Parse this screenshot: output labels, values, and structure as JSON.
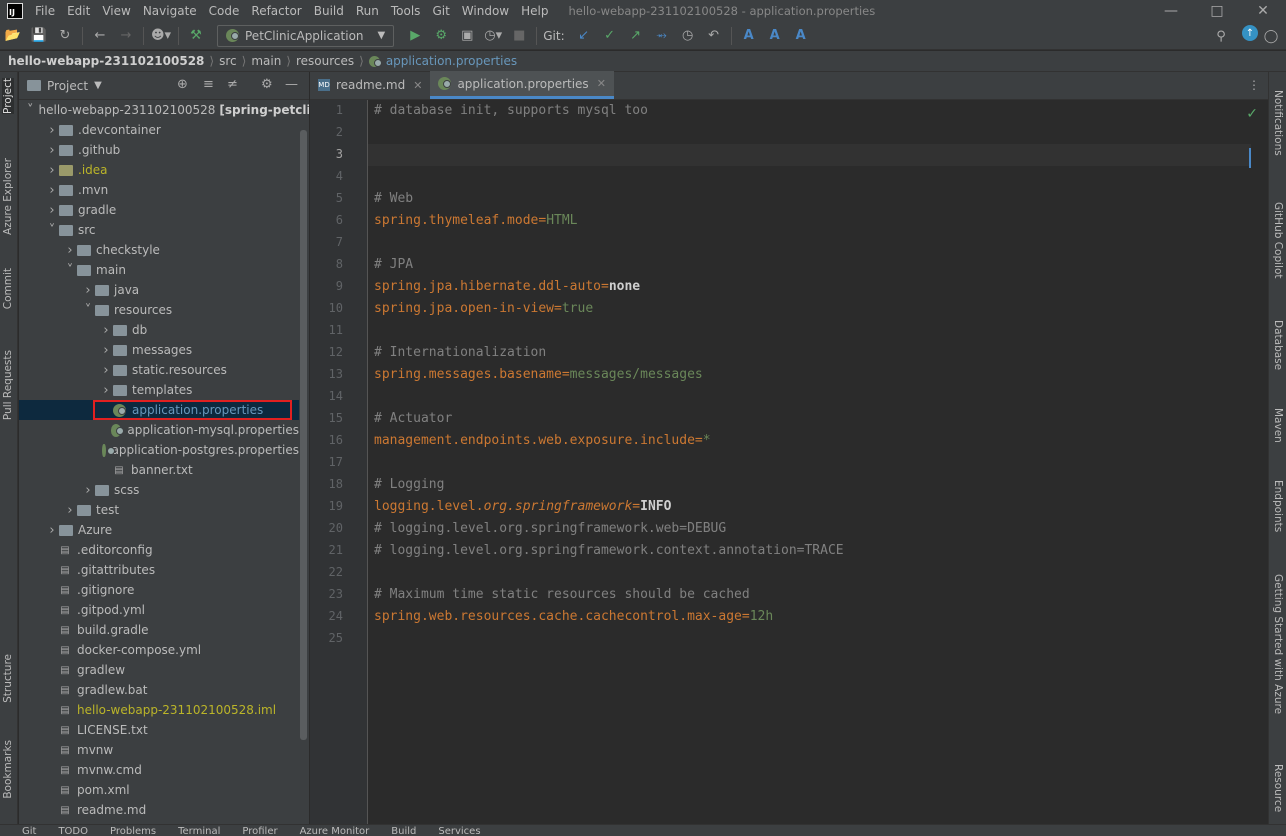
{
  "menu": [
    "File",
    "Edit",
    "View",
    "Navigate",
    "Code",
    "Refactor",
    "Build",
    "Run",
    "Tools",
    "Git",
    "Window",
    "Help"
  ],
  "window_title": "hello-webapp-231102100528 - application.properties",
  "toolbar": {
    "run_config": "PetClinicApplication",
    "git_label": "Git:"
  },
  "breadcrumbs": [
    "hello-webapp-231102100528",
    "src",
    "main",
    "resources",
    "application.properties"
  ],
  "left_strip": [
    "Project",
    "Azure Explorer",
    "Commit",
    "Pull Requests",
    "Structure",
    "Bookmarks"
  ],
  "right_strip": [
    "Notifications",
    "GitHub Copilot",
    "Database",
    "Maven",
    "Endpoints",
    "Getting Started with Azure",
    "Resource"
  ],
  "project_panel": {
    "title": "Project"
  },
  "tree": [
    {
      "label": "hello-webapp-231102100528",
      "extra": "[spring-petclinic]",
      "depth": 0,
      "type": "folder",
      "expanded": true
    },
    {
      "label": ".devcontainer",
      "depth": 1,
      "type": "folder"
    },
    {
      "label": ".github",
      "depth": 1,
      "type": "folder"
    },
    {
      "label": ".idea",
      "depth": 1,
      "type": "folder",
      "color": "yellow"
    },
    {
      "label": ".mvn",
      "depth": 1,
      "type": "folder"
    },
    {
      "label": "gradle",
      "depth": 1,
      "type": "folder"
    },
    {
      "label": "src",
      "depth": 1,
      "type": "folder",
      "expanded": true
    },
    {
      "label": "checkstyle",
      "depth": 2,
      "type": "folder"
    },
    {
      "label": "main",
      "depth": 2,
      "type": "folder",
      "expanded": true
    },
    {
      "label": "java",
      "depth": 3,
      "type": "folder"
    },
    {
      "label": "resources",
      "depth": 3,
      "type": "folder",
      "expanded": true
    },
    {
      "label": "db",
      "depth": 4,
      "type": "folder"
    },
    {
      "label": "messages",
      "depth": 4,
      "type": "folder"
    },
    {
      "label": "static.resources",
      "depth": 4,
      "type": "folder"
    },
    {
      "label": "templates",
      "depth": 4,
      "type": "folder"
    },
    {
      "label": "application.properties",
      "depth": 4,
      "type": "props",
      "selected": true
    },
    {
      "label": "application-mysql.properties",
      "depth": 4,
      "type": "props"
    },
    {
      "label": "application-postgres.properties",
      "depth": 4,
      "type": "props"
    },
    {
      "label": "banner.txt",
      "depth": 4,
      "type": "file"
    },
    {
      "label": "scss",
      "depth": 3,
      "type": "folder"
    },
    {
      "label": "test",
      "depth": 2,
      "type": "folder"
    },
    {
      "label": "Azure",
      "depth": 1,
      "type": "folder"
    },
    {
      "label": ".editorconfig",
      "depth": 1,
      "type": "file"
    },
    {
      "label": ".gitattributes",
      "depth": 1,
      "type": "file"
    },
    {
      "label": ".gitignore",
      "depth": 1,
      "type": "file"
    },
    {
      "label": ".gitpod.yml",
      "depth": 1,
      "type": "file"
    },
    {
      "label": "build.gradle",
      "depth": 1,
      "type": "file"
    },
    {
      "label": "docker-compose.yml",
      "depth": 1,
      "type": "file"
    },
    {
      "label": "gradlew",
      "depth": 1,
      "type": "file"
    },
    {
      "label": "gradlew.bat",
      "depth": 1,
      "type": "file"
    },
    {
      "label": "hello-webapp-231102100528.iml",
      "depth": 1,
      "type": "file",
      "color": "yellow"
    },
    {
      "label": "LICENSE.txt",
      "depth": 1,
      "type": "file"
    },
    {
      "label": "mvnw",
      "depth": 1,
      "type": "file"
    },
    {
      "label": "mvnw.cmd",
      "depth": 1,
      "type": "file"
    },
    {
      "label": "pom.xml",
      "depth": 1,
      "type": "file"
    },
    {
      "label": "readme.md",
      "depth": 1,
      "type": "file"
    }
  ],
  "tabs": [
    {
      "label": "readme.md",
      "active": false
    },
    {
      "label": "application.properties",
      "active": true
    }
  ],
  "code_lines": [
    [
      [
        "com",
        "# database init, supports mysql too"
      ]
    ],
    [],
    [],
    [],
    [
      [
        "com",
        "# Web"
      ]
    ],
    [
      [
        "key",
        "spring.thymeleaf.mode"
      ],
      [
        "eq",
        "="
      ],
      [
        "val",
        "HTML"
      ]
    ],
    [],
    [
      [
        "com",
        "# JPA"
      ]
    ],
    [
      [
        "key",
        "spring.jpa.hibernate.ddl-auto"
      ],
      [
        "eq",
        "="
      ],
      [
        "valb",
        "none"
      ]
    ],
    [
      [
        "key",
        "spring.jpa.open-in-view"
      ],
      [
        "eq",
        "="
      ],
      [
        "val",
        "true"
      ]
    ],
    [],
    [
      [
        "com",
        "# Internationalization"
      ]
    ],
    [
      [
        "key",
        "spring.messages.basename"
      ],
      [
        "eq",
        "="
      ],
      [
        "val",
        "messages/messages"
      ]
    ],
    [],
    [
      [
        "com",
        "# Actuator"
      ]
    ],
    [
      [
        "key",
        "management.endpoints.web.exposure.include"
      ],
      [
        "eq",
        "="
      ],
      [
        "val",
        "*"
      ]
    ],
    [],
    [
      [
        "com",
        "# Logging"
      ]
    ],
    [
      [
        "key",
        "logging.level."
      ],
      [
        "key it",
        "org.springframework"
      ],
      [
        "eq",
        "="
      ],
      [
        "valb",
        "INFO"
      ]
    ],
    [
      [
        "com",
        "# logging.level.org.springframework.web=DEBUG"
      ]
    ],
    [
      [
        "com",
        "# logging.level.org.springframework.context.annotation=TRACE"
      ]
    ],
    [],
    [
      [
        "com",
        "# Maximum time static resources should be cached"
      ]
    ],
    [
      [
        "key",
        "spring.web.resources.cache.cachecontrol.max-age"
      ],
      [
        "eq",
        "="
      ],
      [
        "val",
        "12h"
      ]
    ],
    []
  ],
  "status_items": [
    "Git",
    "TODO",
    "Problems",
    "Terminal",
    "Profiler",
    "Azure Monitor",
    "Build",
    "Services"
  ]
}
